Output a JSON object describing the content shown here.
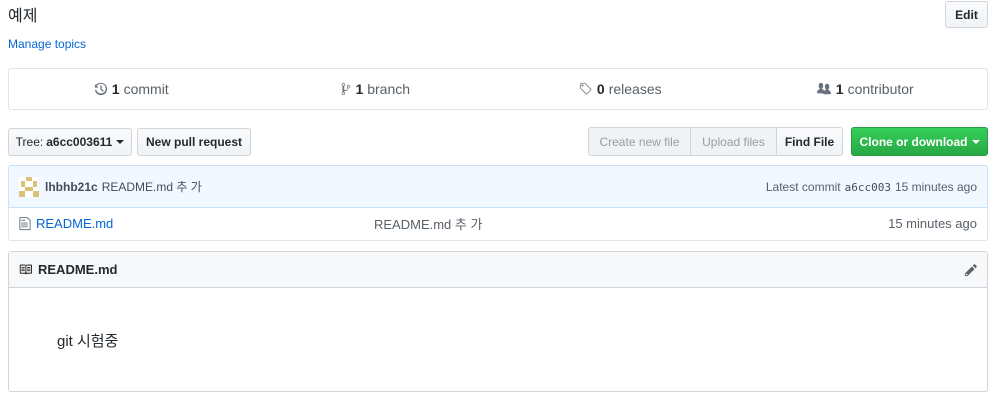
{
  "repo": {
    "description": "예제",
    "manage_topics": "Manage topics",
    "edit_label": "Edit"
  },
  "numbers": {
    "commits_count": "1",
    "commits_label": "commit",
    "branches_count": "1",
    "branches_label": "branch",
    "releases_count": "0",
    "releases_label": "releases",
    "contributors_count": "1",
    "contributors_label": "contributor"
  },
  "toolbar": {
    "tree_label": "Tree:",
    "tree_value": "a6cc003611",
    "new_pull_request": "New pull request",
    "create_new_file": "Create new file",
    "upload_files": "Upload files",
    "find_file": "Find File",
    "clone_or_download": "Clone or download"
  },
  "commit": {
    "author": "lhbhb21c",
    "message": "README.md 추 가",
    "latest_label": "Latest commit",
    "sha": "a6cc003",
    "age": "15 minutes ago"
  },
  "files": [
    {
      "name": "README.md",
      "message": "README.md 추 가",
      "age": "15 minutes ago",
      "icon": "file-icon"
    }
  ],
  "readme": {
    "title": "README.md",
    "content": "git 시험중"
  },
  "colors": {
    "link": "#0366d6",
    "clone_green": "#28a745",
    "commit_bg": "#f1f8ff"
  }
}
